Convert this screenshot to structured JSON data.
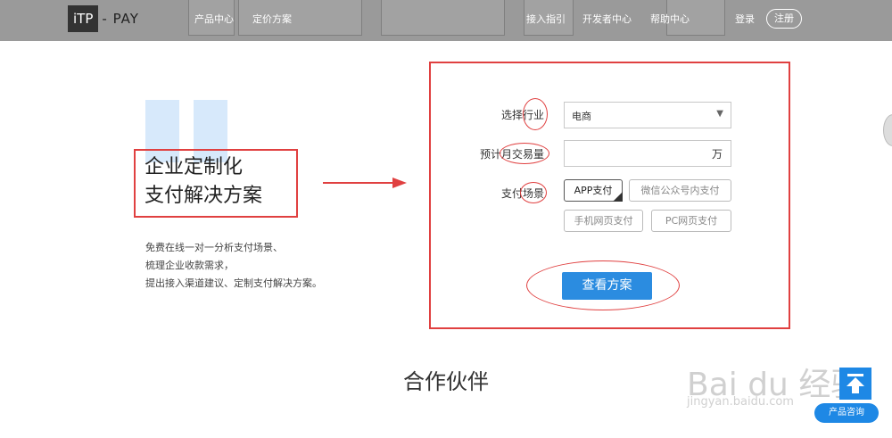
{
  "header": {
    "logo_left": "iTP",
    "logo_right": "PAY",
    "nav_left": [
      "产品中心",
      "定价方案"
    ],
    "nav_right": [
      "接入指引",
      "开发者中心",
      "帮助中心"
    ],
    "login": "登录",
    "register": "注册"
  },
  "hero": {
    "title_line1": "企业定制化",
    "title_line2": "支付解决方案",
    "desc_line1": "免费在线一对一分析支付场景、",
    "desc_line2": "梳理企业收款需求，",
    "desc_line3": "提出接入渠道建议、定制支付解决方案。"
  },
  "form": {
    "industry_label": "选择行业",
    "industry_value": "电商",
    "volume_label": "预计月交易量",
    "volume_unit": "万",
    "scene_label": "支付场景",
    "scenes": [
      "APP支付",
      "微信公众号内支付",
      "手机网页支付",
      "PC网页支付"
    ],
    "selected_scene": "APP支付",
    "submit": "查看方案"
  },
  "partners_title": "合作伙伴",
  "side": {
    "consult": "产品咨询"
  },
  "watermark": {
    "line1": "Bai du 经验",
    "line2": "jingyan.baidu.com"
  },
  "colors": {
    "header_bg": "#9a9a9a",
    "primary": "#2b8ce0",
    "annotation_red": "#e04040"
  }
}
